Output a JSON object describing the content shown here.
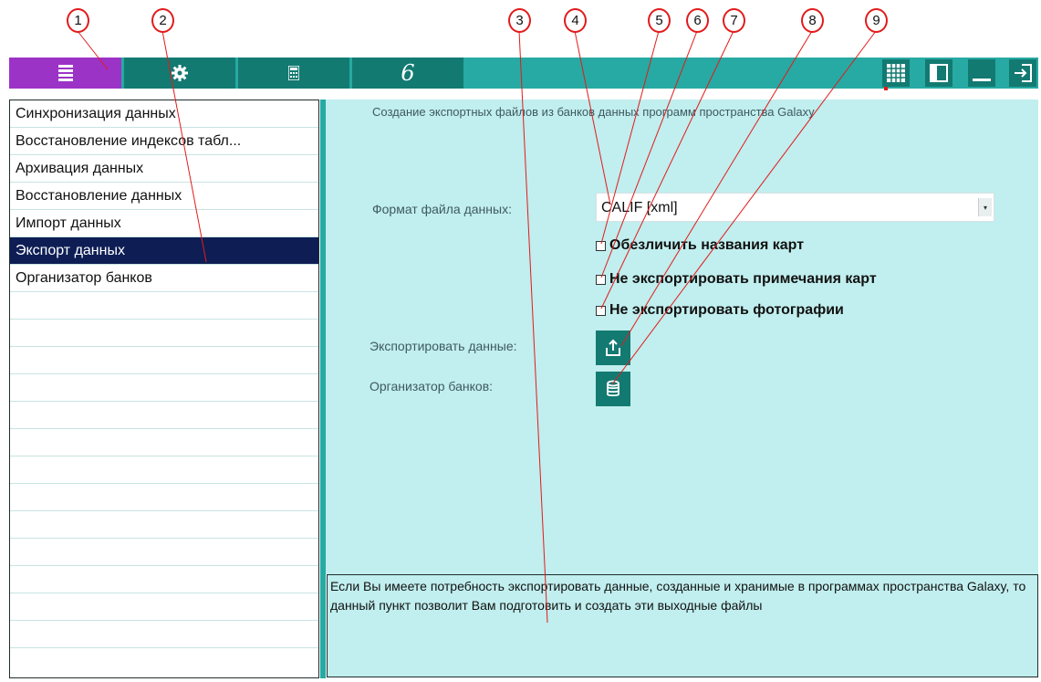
{
  "toolbar": {
    "buttons": [
      {
        "icon": "menu-icon"
      },
      {
        "icon": "gear-icon"
      },
      {
        "icon": "calculator-icon"
      },
      {
        "icon": "galaxy-logo-icon",
        "glyph": "6"
      }
    ],
    "right_buttons": [
      {
        "icon": "grid-icon"
      },
      {
        "icon": "panel-icon"
      },
      {
        "icon": "minimize-icon"
      },
      {
        "icon": "exit-icon"
      }
    ]
  },
  "sidebar": {
    "items": [
      "Синхронизация данных",
      "Восстановление индексов табл...",
      "Архивация данных",
      "Восстановление данных",
      "Импорт данных",
      "Экспорт данных",
      "Организатор банков"
    ],
    "selected_index": 5,
    "empty_rows": 13
  },
  "main": {
    "title": "Создание экспортных файлов из банков данных программ пространства Galaxy",
    "format_label": "Формат файла данных:",
    "format_value": "CALIF [xml]",
    "checkboxes": [
      "Обезличить названия карт",
      "Не экспортировать примечания карт",
      "Не экспортировать фотографии"
    ],
    "export_label": "Экспортировать данные:",
    "organizer_label": "Организатор банков:"
  },
  "description": "Если Вы имеете потребность экспортировать данные, созданные и хранимые в программах пространства Galaxy, то данный пункт позволит Вам подготовить и создать эти выходные файлы",
  "markers": [
    "1",
    "2",
    "3",
    "4",
    "5",
    "6",
    "7",
    "8",
    "9"
  ],
  "colors": {
    "accent_purple": "#9c33c7",
    "dark_teal": "#137a72",
    "teal": "#26aaa3",
    "panel_bg": "#c1eeee",
    "selected_bg": "#0e1e55",
    "callout_red": "#e21b1b"
  }
}
